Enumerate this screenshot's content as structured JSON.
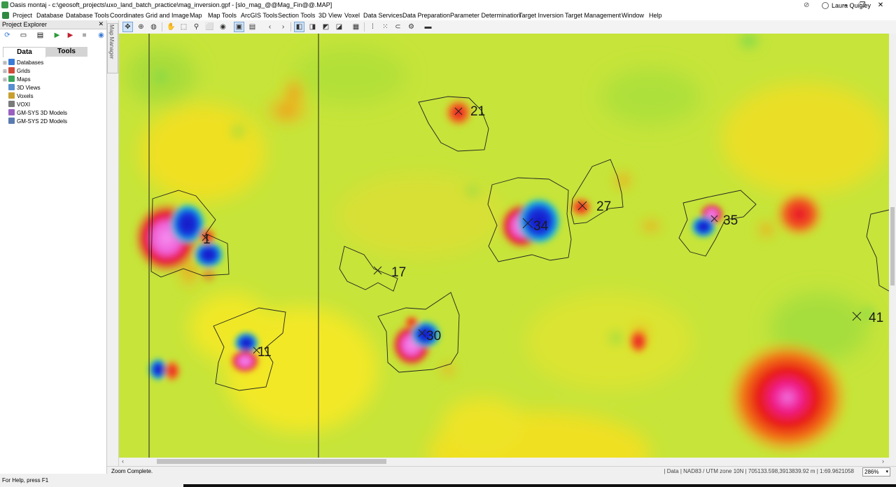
{
  "window": {
    "title": "Oasis montaj - c:\\geosoft_projects\\uxo_land_batch_practice\\mag_inversion.gpf - [slo_mag_@@Mag_Fin@@.MAP]",
    "user": "Laura Quigley",
    "minimize": "–",
    "maximize": "❐",
    "close": "✕"
  },
  "menu": [
    "Project",
    "Database",
    "Database Tools",
    "Coordinates",
    "Grid and Image",
    "Map",
    "Map Tools",
    "ArcGIS Tools",
    "Section Tools",
    "3D View",
    "Voxel",
    "Data Services",
    "Data Preparation",
    "Parameter Determination",
    "Target Inversion",
    "Target Management",
    "Window",
    "Help"
  ],
  "explorer": {
    "title": "Project Explorer",
    "pin": "✕",
    "tabs": {
      "data": "Data",
      "tools": "Tools"
    },
    "items": [
      {
        "label": "Databases",
        "color": "#3a7bd5",
        "expandable": true
      },
      {
        "label": "Grids",
        "color": "#d04a3a",
        "expandable": true
      },
      {
        "label": "Maps",
        "color": "#3aa55a",
        "expandable": true
      },
      {
        "label": "3D Views",
        "color": "#5a8fd0",
        "expandable": false
      },
      {
        "label": "Voxels",
        "color": "#c8a030",
        "expandable": false
      },
      {
        "label": "VOXI",
        "color": "#7a7a7a",
        "expandable": false
      },
      {
        "label": "GM-SYS 3D Models",
        "color": "#9a60c0",
        "expandable": false
      },
      {
        "label": "GM-SYS 2D Models",
        "color": "#5a7ab0",
        "expandable": false
      }
    ]
  },
  "map_manager": {
    "label": "Map Manager"
  },
  "map": {
    "targets": [
      {
        "label": "1"
      },
      {
        "label": "11"
      },
      {
        "label": "17"
      },
      {
        "label": "21"
      },
      {
        "label": "27"
      },
      {
        "label": "30"
      },
      {
        "label": "34"
      },
      {
        "label": "35"
      },
      {
        "label": "41"
      }
    ]
  },
  "status": {
    "map_message": "Zoom Complete.",
    "coords": "| Data  | NAD83 / UTM zone 10N  | 705133.598,3913839.92 m  | 1:69.9621058",
    "zoom": "286%",
    "help": "For Help, press F1"
  }
}
